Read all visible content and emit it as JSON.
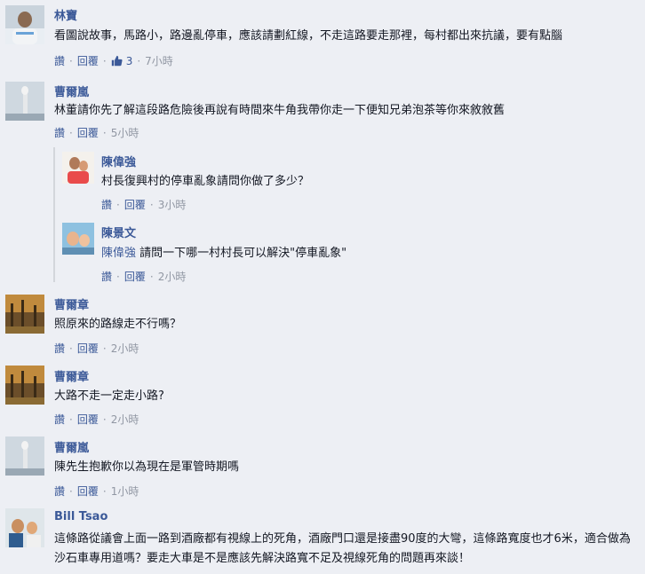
{
  "actions": {
    "like": "讚",
    "reply": "回覆",
    "sep": "·"
  },
  "comments": [
    {
      "name": "林寶",
      "text": "看圖說故事，馬路小，路邊亂停車，應該請劃紅線，不走這路要走那裡，每村都出來抗議，要有點腦",
      "likes": "3",
      "time": "7小時"
    },
    {
      "name": "曹爾嵐",
      "text": "林董請你先了解這段路危險後再說有時間來牛角我帶你走一下便知兄弟泡茶等你來敘敘舊",
      "time": "5小時",
      "replies": [
        {
          "name": "陳偉強",
          "text": "村長復興村的停車亂象請問你做了多少？",
          "time": "3小時"
        },
        {
          "name": "陳景文",
          "mention": "陳偉強",
          "text": "請問一下哪一村村長可以解決\"停車亂象\"",
          "time": "2小時"
        }
      ]
    },
    {
      "name": "曹爾章",
      "text": "照原來的路線走不行嗎？",
      "time": "2小時"
    },
    {
      "name": "曹爾章",
      "text": "大路不走一定走小路?",
      "time": "2小時"
    },
    {
      "name": "曹爾嵐",
      "text": "陳先生抱歉你以為現在是軍管時期嗎",
      "time": "1小時"
    },
    {
      "name": "Bill Tsao",
      "text": "這條路從議會上面一路到酒廠都有視線上的死角，酒廠門口還是接盡90度的大彎，這條路寬度也才6米，適合做為沙石車專用道嗎？要走大車是不是應該先解決路寬不足及視線死角的問題再來談！"
    }
  ]
}
